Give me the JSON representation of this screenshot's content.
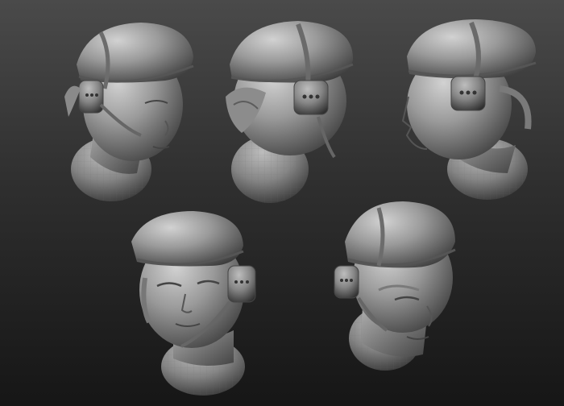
{
  "scene": {
    "background_top": "#4a4a4a",
    "background_bottom": "#161616",
    "material_color": "#9a9a9a",
    "subject": "sculpted-female-head-with-beret-and-headset",
    "views": [
      {
        "id": "view-1",
        "angle": "three-quarter-right"
      },
      {
        "id": "view-2",
        "angle": "back-left"
      },
      {
        "id": "view-3",
        "angle": "profile-left"
      },
      {
        "id": "view-4",
        "angle": "front-three-quarter"
      },
      {
        "id": "view-5",
        "angle": "three-quarter-low-right"
      }
    ]
  }
}
